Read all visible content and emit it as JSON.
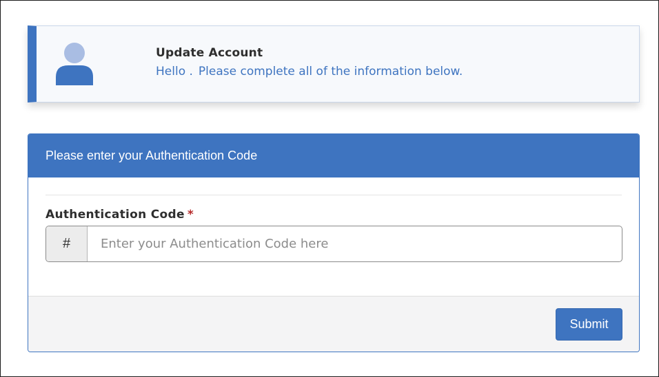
{
  "account": {
    "title": "Update Account",
    "greeting_hello": "Hello .",
    "greeting_message": "Please complete all of the information below.",
    "avatar_icon": "user-avatar-icon"
  },
  "auth_panel": {
    "header": "Please enter your Authentication Code",
    "field_label": "Authentication Code",
    "required_marker": "*",
    "addon_symbol": "#",
    "input_value": "",
    "input_placeholder": "Enter your Authentication Code here",
    "submit_label": "Submit"
  },
  "colors": {
    "accent": "#3e74c0",
    "avatar_head": "#a9bde3",
    "avatar_body": "#3e74c0",
    "required": "#b52a2a"
  }
}
